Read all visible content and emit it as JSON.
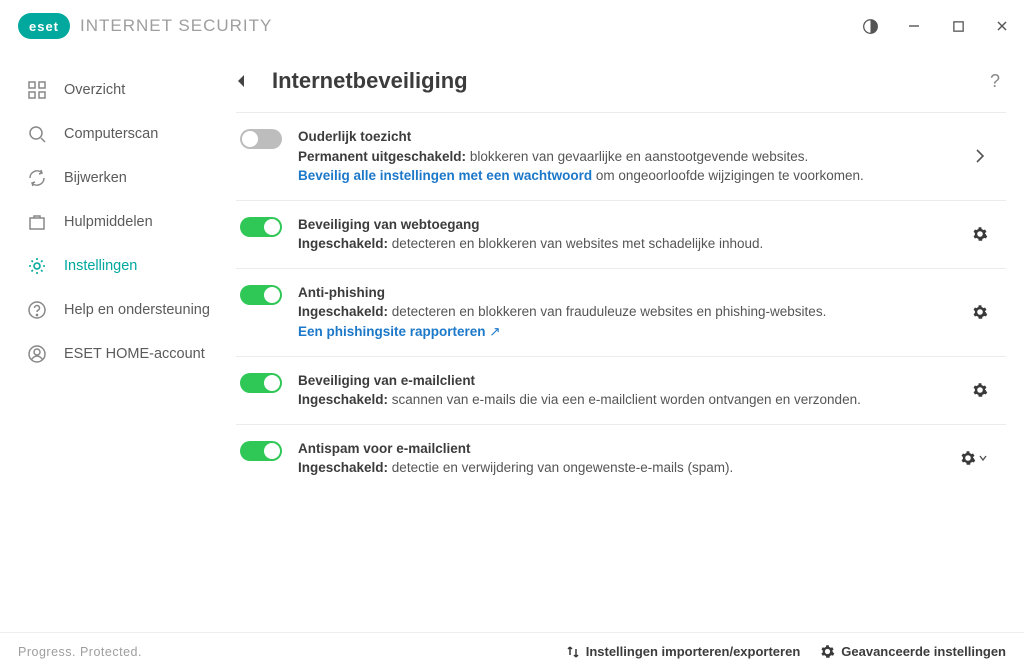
{
  "app": {
    "brand": "eset",
    "product": "INTERNET SECURITY"
  },
  "sidebar": {
    "items": [
      {
        "label": "Overzicht"
      },
      {
        "label": "Computerscan"
      },
      {
        "label": "Bijwerken"
      },
      {
        "label": "Hulpmiddelen"
      },
      {
        "label": "Instellingen"
      },
      {
        "label": "Help en ondersteuning"
      },
      {
        "label": "ESET HOME-account"
      }
    ]
  },
  "page": {
    "title": "Internetbeveiliging"
  },
  "settings": {
    "parental": {
      "title": "Ouderlijk toezicht",
      "status": "Permanent uitgeschakeld:",
      "desc": "blokkeren van gevaarlijke en aanstootgevende websites.",
      "link": "Beveilig alle instellingen met een wachtwoord",
      "after_link": "om ongeoorloofde wijzigingen te voorkomen."
    },
    "webaccess": {
      "title": "Beveiliging van webtoegang",
      "status": "Ingeschakeld:",
      "desc": "detecteren en blokkeren van websites met schadelijke inhoud."
    },
    "antiphishing": {
      "title": "Anti-phishing",
      "status": "Ingeschakeld:",
      "desc": "detecteren en blokkeren van frauduleuze websites en phishing-websites.",
      "link": "Een phishingsite rapporteren"
    },
    "emailclient": {
      "title": "Beveiliging van e-mailclient",
      "status": "Ingeschakeld:",
      "desc": "scannen van e-mails die via een e-mailclient worden ontvangen en verzonden."
    },
    "antispam": {
      "title": "Antispam voor e-mailclient",
      "status": "Ingeschakeld:",
      "desc": "detectie en verwijdering van ongewenste-e-mails (spam)."
    }
  },
  "footer": {
    "tagline": "Progress. Protected.",
    "import_export": "Instellingen importeren/exporteren",
    "advanced": "Geavanceerde instellingen"
  }
}
